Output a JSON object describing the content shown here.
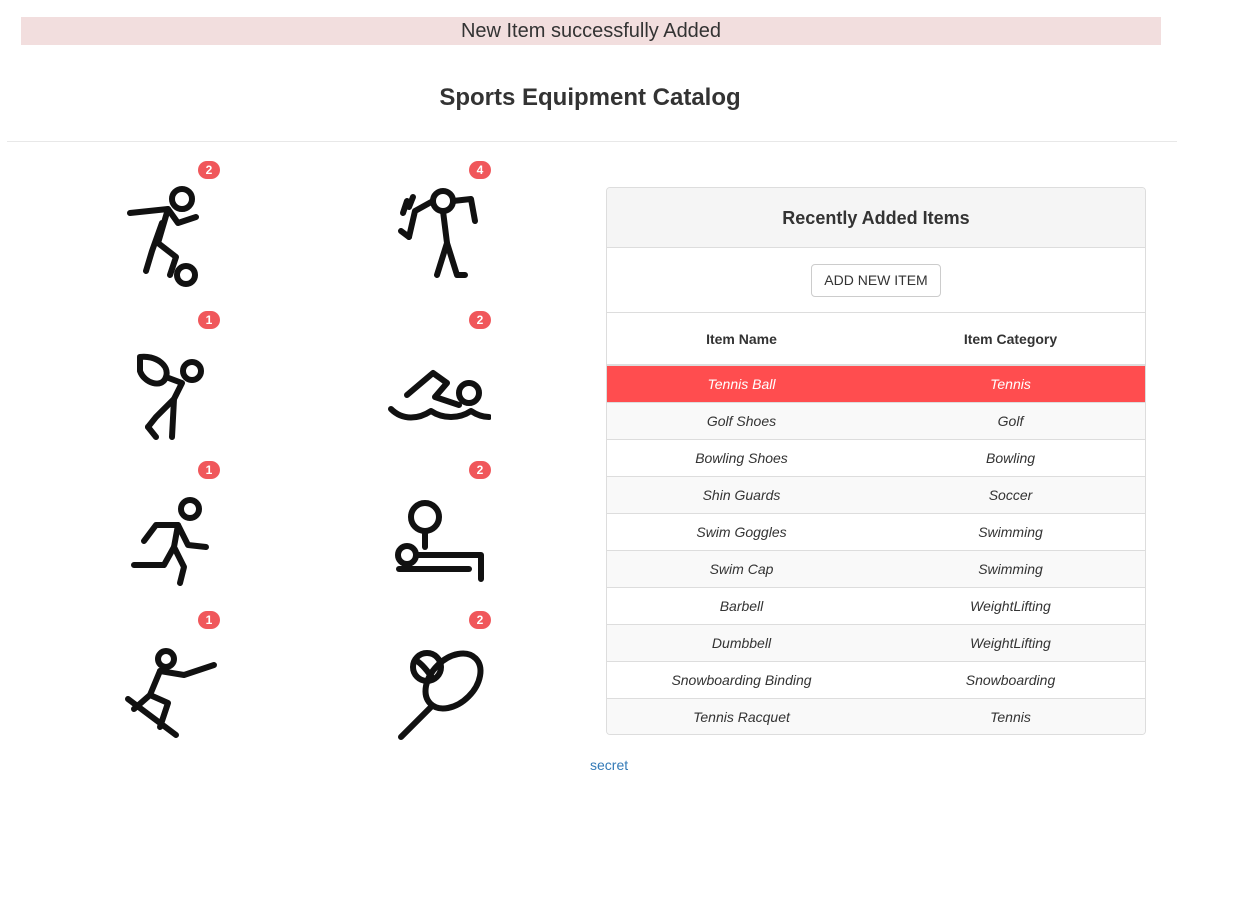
{
  "flash_message": "New Item successfully Added",
  "page_title": "Sports Equipment Catalog",
  "categories": [
    {
      "name": "soccer-icon",
      "count": "2"
    },
    {
      "name": "golf-icon",
      "count": "4"
    },
    {
      "name": "bowling-icon",
      "count": "1"
    },
    {
      "name": "swimming-icon",
      "count": "2"
    },
    {
      "name": "running-icon",
      "count": "1"
    },
    {
      "name": "weightlifting-icon",
      "count": "2"
    },
    {
      "name": "snowboarding-icon",
      "count": "1"
    },
    {
      "name": "tennis-icon",
      "count": "2"
    }
  ],
  "panel": {
    "title": "Recently Added Items",
    "add_button_label": "ADD NEW ITEM",
    "columns": [
      "Item Name",
      "Item Category"
    ],
    "rows": [
      {
        "name": "Tennis Ball",
        "category": "Tennis"
      },
      {
        "name": "Golf Shoes",
        "category": "Golf"
      },
      {
        "name": "Bowling Shoes",
        "category": "Bowling"
      },
      {
        "name": "Shin Guards",
        "category": "Soccer"
      },
      {
        "name": "Swim Goggles",
        "category": "Swimming"
      },
      {
        "name": "Swim Cap",
        "category": "Swimming"
      },
      {
        "name": "Barbell",
        "category": "WeightLifting"
      },
      {
        "name": "Dumbbell",
        "category": "WeightLifting"
      },
      {
        "name": "Snowboarding Binding",
        "category": "Snowboarding"
      },
      {
        "name": "Tennis Racquet",
        "category": "Tennis"
      }
    ]
  },
  "footer_link": "secret",
  "colors": {
    "flash_bg": "#f2dede",
    "badge": "#f0575b",
    "active_row": "#ff4d4f",
    "link": "#337ab7"
  }
}
